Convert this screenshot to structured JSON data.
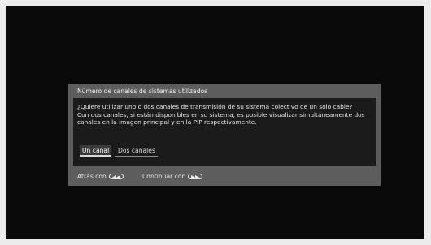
{
  "dialog": {
    "title": "Número de canales de sistemas utilizados",
    "body_lines": [
      "¿Quiere utilizar uno o dos canales de transmisión de su sistema colectivo de un solo cable?",
      "Con dos canales, si están disponibles en su sistema, es posible visualizar simultáneamente dos",
      "canales en la imagen principal y en la PIP respectivamente."
    ],
    "options": [
      {
        "label": "Un canal",
        "selected": true
      },
      {
        "label": "Dos canales",
        "selected": false
      }
    ],
    "footer": {
      "back_label": "Atrás con",
      "back_icon": "rewind-button-icon",
      "continue_label": "Continuar con",
      "continue_icon": "fast-forward-button-icon"
    }
  }
}
